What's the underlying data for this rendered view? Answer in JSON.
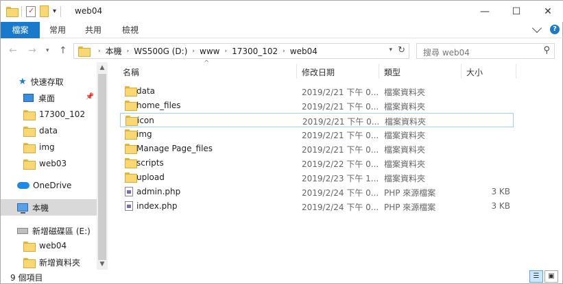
{
  "window": {
    "title": "web04"
  },
  "ribbon": {
    "tabs": [
      "檔案",
      "常用",
      "共用",
      "檢視"
    ]
  },
  "address": {
    "crumbs": [
      "本機",
      "WS500G (D:)",
      "www",
      "17300_102",
      "web04"
    ]
  },
  "search": {
    "placeholder": "搜尋 web04"
  },
  "nav_pane": {
    "items": [
      {
        "label": "快速存取",
        "icon": "star-icon"
      },
      {
        "label": "桌面",
        "icon": "desktop-icon"
      },
      {
        "label": "17300_102",
        "icon": "folder-icon"
      },
      {
        "label": "data",
        "icon": "folder-icon"
      },
      {
        "label": "img",
        "icon": "folder-icon"
      },
      {
        "label": "web03",
        "icon": "folder-icon"
      },
      {
        "label": "OneDrive",
        "icon": "cloud-icon"
      },
      {
        "label": "本機",
        "icon": "computer-icon"
      },
      {
        "label": "新增磁碟區 (E:)",
        "icon": "drive-icon"
      },
      {
        "label": "web04",
        "icon": "folder-icon"
      },
      {
        "label": "新增資料夾",
        "icon": "folder-icon"
      }
    ]
  },
  "columns": {
    "name": "名稱",
    "date": "修改日期",
    "type": "類型",
    "size": "大小"
  },
  "files": [
    {
      "name": "data",
      "date": "2019/2/21 下午 0...",
      "type": "檔案資料夾",
      "size": "",
      "kind": "folder"
    },
    {
      "name": "home_files",
      "date": "2019/2/21 下午 0...",
      "type": "檔案資料夾",
      "size": "",
      "kind": "folder"
    },
    {
      "name": "icon",
      "date": "2019/2/21 下午 0...",
      "type": "檔案資料夾",
      "size": "",
      "kind": "folder"
    },
    {
      "name": "img",
      "date": "2019/2/21 下午 0...",
      "type": "檔案資料夾",
      "size": "",
      "kind": "folder"
    },
    {
      "name": "Manage Page_files",
      "date": "2019/2/21 下午 0...",
      "type": "檔案資料夾",
      "size": "",
      "kind": "folder"
    },
    {
      "name": "scripts",
      "date": "2019/2/22 下午 0...",
      "type": "檔案資料夾",
      "size": "",
      "kind": "folder"
    },
    {
      "name": "upload",
      "date": "2019/2/23 下午 1...",
      "type": "檔案資料夾",
      "size": "",
      "kind": "folder"
    },
    {
      "name": "admin.php",
      "date": "2019/2/24 下午 0...",
      "type": "PHP 來源檔案",
      "size": "3 KB",
      "kind": "php"
    },
    {
      "name": "index.php",
      "date": "2019/2/24 下午 0...",
      "type": "PHP 來源檔案",
      "size": "3 KB",
      "kind": "php"
    }
  ],
  "status": {
    "count": "9 個項目"
  },
  "colors": {
    "accent": "#1979ca",
    "selected_nav": "#d9d9d9",
    "focus_border": "#99d1ff"
  }
}
